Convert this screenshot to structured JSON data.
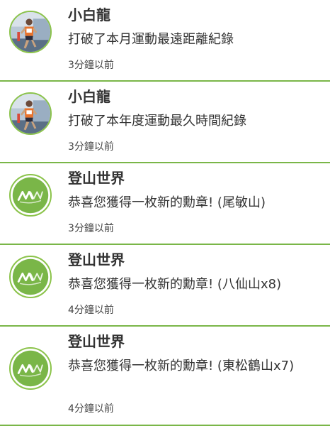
{
  "feed": {
    "items": [
      {
        "name": "小白龍",
        "message": "打破了本月運動最遠距離紀錄",
        "time": "3分鐘以前",
        "avatar": "runner-photo-icon"
      },
      {
        "name": "小白龍",
        "message": "打破了本年度運動最久時間紀錄",
        "time": "3分鐘以前",
        "avatar": "runner-photo-icon"
      },
      {
        "name": "登山世界",
        "message": "恭喜您獲得一枚新的勳章! (尾敏山)",
        "time": "3分鐘以前",
        "avatar": "mountain-world-logo-icon"
      },
      {
        "name": "登山世界",
        "message": "恭喜您獲得一枚新的勳章! (八仙山x8)",
        "time": "4分鐘以前",
        "avatar": "mountain-world-logo-icon"
      },
      {
        "name": "登山世界",
        "message": "恭喜您獲得一枚新的勳章! (東松鶴山x7)",
        "time": "4分鐘以前",
        "avatar": "mountain-world-logo-icon"
      }
    ]
  },
  "colors": {
    "divider": "#7ab648",
    "logo_green": "#7ab648",
    "avatar_ring": "#8bc34a",
    "text": "#333333"
  }
}
